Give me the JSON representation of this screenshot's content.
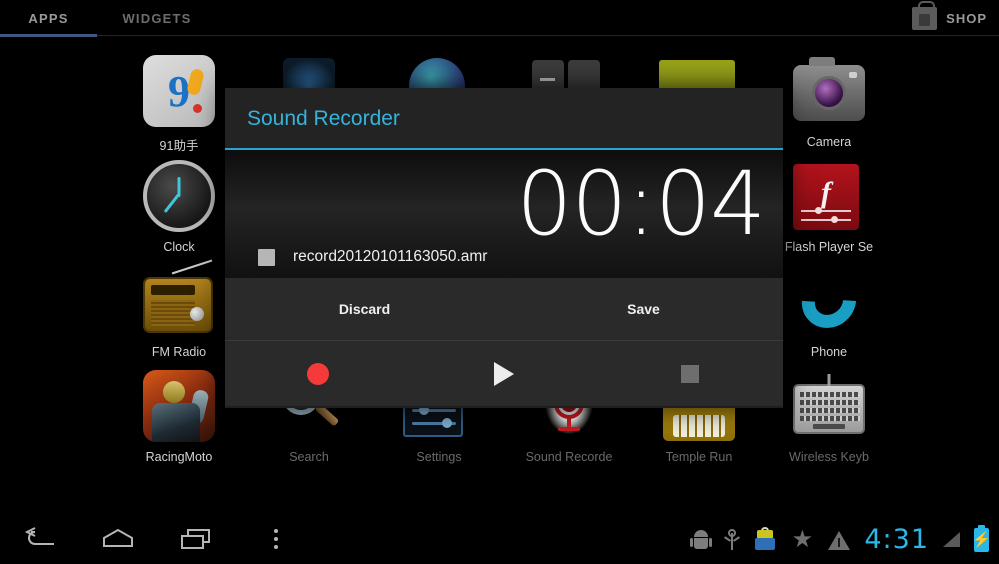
{
  "topbar": {
    "tabs": [
      {
        "label": "APPS",
        "active": true
      },
      {
        "label": "WIDGETS",
        "active": false
      }
    ],
    "shop": {
      "label": "SHOP",
      "icon": "shopping-bag-icon"
    },
    "active_tab_color": "#42577d"
  },
  "apps": {
    "left_column": [
      {
        "label": "91助手",
        "icon": "app-91-assistant-icon"
      },
      {
        "label": "Clock",
        "icon": "clock-icon"
      },
      {
        "label": "FM Radio",
        "icon": "fm-radio-icon"
      },
      {
        "label": "RacingMoto",
        "icon": "racing-moto-icon"
      }
    ],
    "right_column": [
      {
        "label": "Camera",
        "icon": "camera-icon"
      },
      {
        "label": "Flash Player Se",
        "icon": "flash-player-icon"
      },
      {
        "label": "Phone",
        "icon": "phone-icon"
      }
    ],
    "bottom_row": [
      {
        "label": "Search",
        "icon": "magnifier-icon"
      },
      {
        "label": "Settings",
        "icon": "sliders-icon"
      },
      {
        "label": "Sound Recorde",
        "icon": "microphone-icon"
      },
      {
        "label": "Temple Run",
        "icon": "temple-run-icon"
      },
      {
        "label": "Wireless Keyb",
        "icon": "keyboard-icon"
      }
    ]
  },
  "dialog": {
    "title": "Sound Recorder",
    "title_color": "#35b3dc",
    "timer": "00:04",
    "file_name": "record20120101163050.amr",
    "file_icon": "file-square-icon",
    "actions": [
      {
        "label": "Discard",
        "name": "discard-button"
      },
      {
        "label": "Save",
        "name": "save-button"
      }
    ],
    "transport": [
      {
        "icon": "record-icon",
        "name": "record-button",
        "color": "#f63a3a"
      },
      {
        "icon": "play-icon",
        "name": "play-button",
        "color": "#ededed"
      },
      {
        "icon": "stop-icon",
        "name": "stop-button",
        "color": "#6e6e6e"
      }
    ]
  },
  "navbar": {
    "buttons": [
      {
        "icon": "back-arrow-icon",
        "name": "back-button"
      },
      {
        "icon": "home-icon",
        "name": "home-button"
      },
      {
        "icon": "recent-apps-icon",
        "name": "recent-apps-button"
      },
      {
        "icon": "overflow-menu-icon",
        "name": "menu-button"
      }
    ],
    "status": {
      "icons": [
        "android-robot-icon",
        "usb-icon",
        "toolbox-icon",
        "star-icon",
        "warning-triangle-icon"
      ],
      "time": "4:31",
      "time_color": "#2bb8e8",
      "signal_icon": "signal-bars-icon",
      "battery_icon": "battery-charging-icon"
    }
  }
}
